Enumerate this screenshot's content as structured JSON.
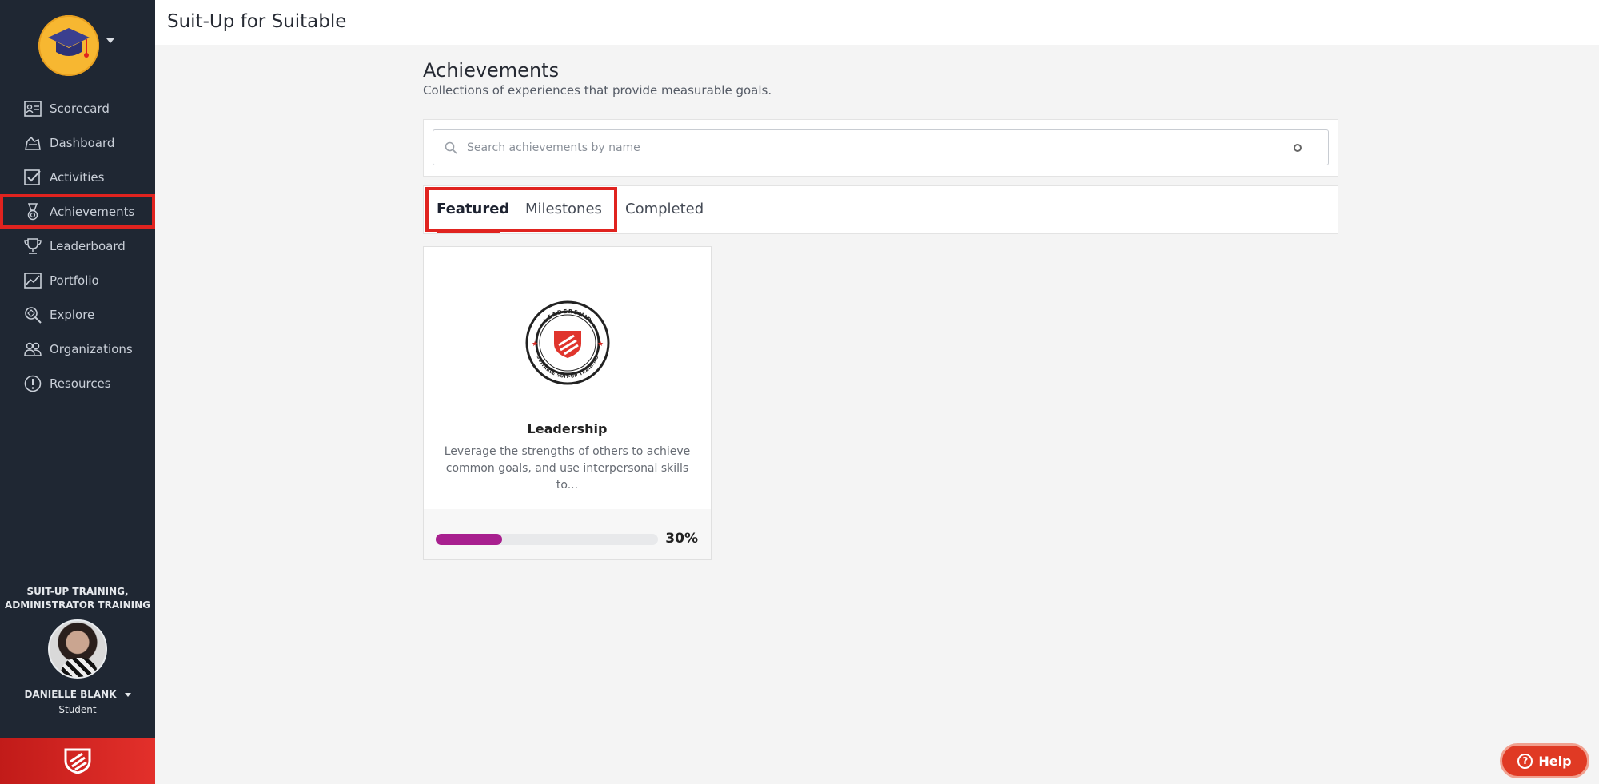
{
  "app": {
    "title": "Suit-Up for Suitable"
  },
  "sidebar": {
    "items": [
      {
        "label": "Scorecard",
        "icon": "scorecard-icon"
      },
      {
        "label": "Dashboard",
        "icon": "dashboard-icon"
      },
      {
        "label": "Activities",
        "icon": "checkbox-icon"
      },
      {
        "label": "Achievements",
        "icon": "medal-icon",
        "highlighted": true
      },
      {
        "label": "Leaderboard",
        "icon": "trophy-icon"
      },
      {
        "label": "Portfolio",
        "icon": "chart-icon"
      },
      {
        "label": "Explore",
        "icon": "explore-icon"
      },
      {
        "label": "Organizations",
        "icon": "people-icon"
      },
      {
        "label": "Resources",
        "icon": "info-icon"
      }
    ],
    "org_label_line1": "SUIT-UP TRAINING,",
    "org_label_line2": "ADMINISTRATOR TRAINING",
    "user_name": "DANIELLE BLANK",
    "user_role": "Student"
  },
  "main": {
    "title": "Achievements",
    "subtitle": "Collections of experiences that provide measurable goals.",
    "search": {
      "placeholder": "Search achievements by name",
      "value": ""
    },
    "tabs": [
      {
        "label": "Featured",
        "active": true
      },
      {
        "label": "Milestones",
        "active": false
      },
      {
        "label": "Completed",
        "active": false
      }
    ],
    "cards": [
      {
        "name": "Leadership",
        "description": "Leverage the strengths of others to achieve common goals, and use interpersonal skills to...",
        "progress_label": "30%",
        "progress": 0.3,
        "badge_text_top": "LEADERSHIP",
        "badge_text_bottom": "SUITABLE SUIT-UP TRAINING"
      }
    ]
  },
  "help": {
    "label": "Help"
  },
  "colors": {
    "sidebar": "#1f2733",
    "accent": "#e0231f",
    "progress": "#a8208f",
    "logo": "#f7b731"
  }
}
